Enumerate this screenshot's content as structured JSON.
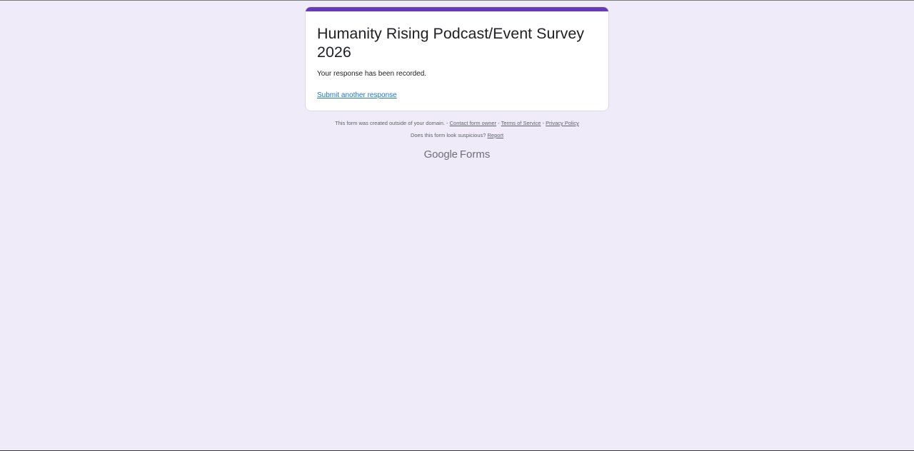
{
  "form": {
    "title": "Humanity Rising Podcast/Event Survey 2026",
    "confirmation_message": "Your response has been recorded.",
    "submit_another_label": "Submit another response",
    "accent_color": "#673ab7",
    "background_color": "#efebf8"
  },
  "footer": {
    "domain_notice": "This form was created outside of your domain.",
    "separator": " - ",
    "contact_owner_label": "Contact form owner",
    "terms_label": "Terms of Service",
    "privacy_label": "Privacy Policy",
    "suspicious_question": "Does this form look suspicious?",
    "report_label": "Report"
  },
  "brand": {
    "google": "Google",
    "forms": "Forms"
  }
}
